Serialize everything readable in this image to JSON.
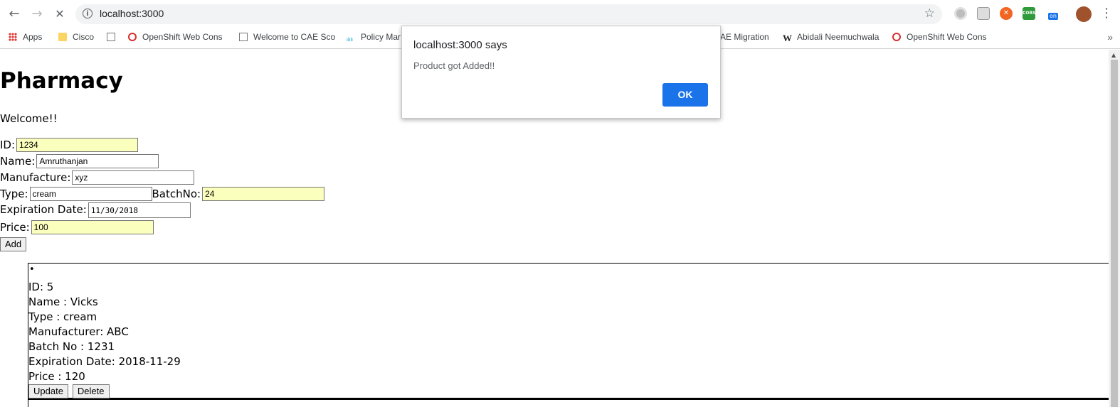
{
  "browser": {
    "url": "localhost:3000",
    "extensions": [
      {
        "name": "circle-extension-icon"
      },
      {
        "name": "book-extension-icon"
      },
      {
        "name": "orange-extension-icon",
        "label": "✕"
      },
      {
        "name": "cors-extension-icon",
        "label": "CORS"
      },
      {
        "name": "cors-toggle-extension-icon",
        "label": "on"
      }
    ],
    "bookmarks": [
      {
        "label": "Apps",
        "icon": "apps-icon"
      },
      {
        "label": "Cisco",
        "icon": "folder-icon"
      },
      {
        "label": "",
        "icon": "page-icon"
      },
      {
        "label": "OpenShift Web Cons",
        "icon": "openshift-icon"
      },
      {
        "label": "Welcome to CAE Sco",
        "icon": "page-icon"
      },
      {
        "label": "Policy Mar",
        "icon": "cisco-icon"
      },
      {
        "label": "AE Migration",
        "icon": ""
      },
      {
        "label": "Abidali Neemuchwala",
        "icon": "wikipedia-icon"
      },
      {
        "label": "OpenShift Web Cons",
        "icon": "openshift-icon"
      }
    ],
    "bookmarks_more": "»"
  },
  "page": {
    "title": "Pharmacy",
    "welcome": "Welcome!!",
    "form": {
      "id_label": "ID:",
      "id_value": "1234",
      "name_label": "Name:",
      "name_value": "Amruthanjan",
      "manufacture_label": "Manufacture:",
      "manufacture_value": "xyz",
      "type_label": "Type:",
      "type_value": "cream",
      "batch_label": "BatchNo:",
      "batch_value": "24",
      "expiration_label": "Expiration Date:",
      "expiration_value": "11/30/2018",
      "price_label": "Price:",
      "price_value": "100",
      "add_button": "Add"
    },
    "products": [
      {
        "bullet": "•",
        "id": "ID: 5",
        "name": "Name : Vicks",
        "type": "Type : cream",
        "manufacturer": "Manufacturer: ABC",
        "batch": "Batch No : 1231",
        "expiration": "Expiration Date: 2018-11-29",
        "price": "Price : 120",
        "update_button": "Update",
        "delete_button": "Delete"
      }
    ]
  },
  "dialog": {
    "title": "localhost:3000 says",
    "message": "Product got Added!!",
    "ok_button": "OK",
    "accent_color": "#1a73e8"
  }
}
